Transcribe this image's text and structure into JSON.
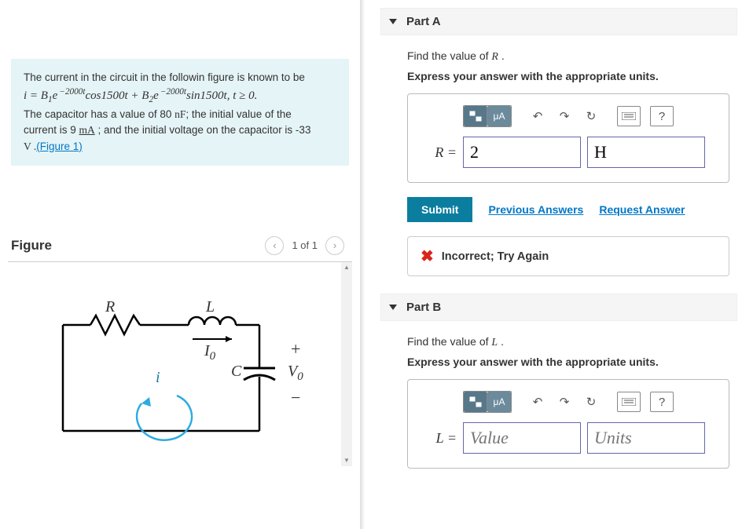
{
  "problem": {
    "line1": "The current in the circuit in the followin figure is known to be",
    "equation_html": "i = B<sub>1</sub>e<sup>&nbsp;2000t</sup>cos1500t + B<sub>2</sub>e<sup>&nbsp;2000t</sup>sin1500t, t ≥ 0.",
    "line2a": "The capacitor has a value of 80 ",
    "cap_unit": "nF",
    "line2b": "; the initial value of the",
    "line3a": "current is 9 ",
    "cur_unit": "mA",
    "line3b": " ; and the initial voltage on the capacitor is -33",
    "line4a": "V .",
    "figure_link": "(Figure 1)"
  },
  "figure": {
    "title": "Figure",
    "counter": "1 of 1",
    "labels": {
      "R": "R",
      "L": "L",
      "I0": "I",
      "i": "i",
      "C": "C",
      "V0": "V",
      "plus": "+",
      "minus": "−"
    }
  },
  "partA": {
    "header": "Part A",
    "prompt_prefix": "Find the value of ",
    "var": "R",
    "prompt_suffix": " .",
    "units_prompt": "Express your answer with the appropriate units.",
    "toolbar_unit": "μA",
    "answer_label": "R = ",
    "value": "2",
    "units": "H",
    "submit": "Submit",
    "prev_answers": "Previous Answers",
    "request_answer": "Request Answer",
    "feedback": "Incorrect; Try Again"
  },
  "partB": {
    "header": "Part B",
    "prompt_prefix": "Find the value of ",
    "var": "L",
    "prompt_suffix": " .",
    "units_prompt": "Express your answer with the appropriate units.",
    "toolbar_unit": "μA",
    "answer_label": "L = ",
    "value_placeholder": "Value",
    "units_placeholder": "Units"
  }
}
